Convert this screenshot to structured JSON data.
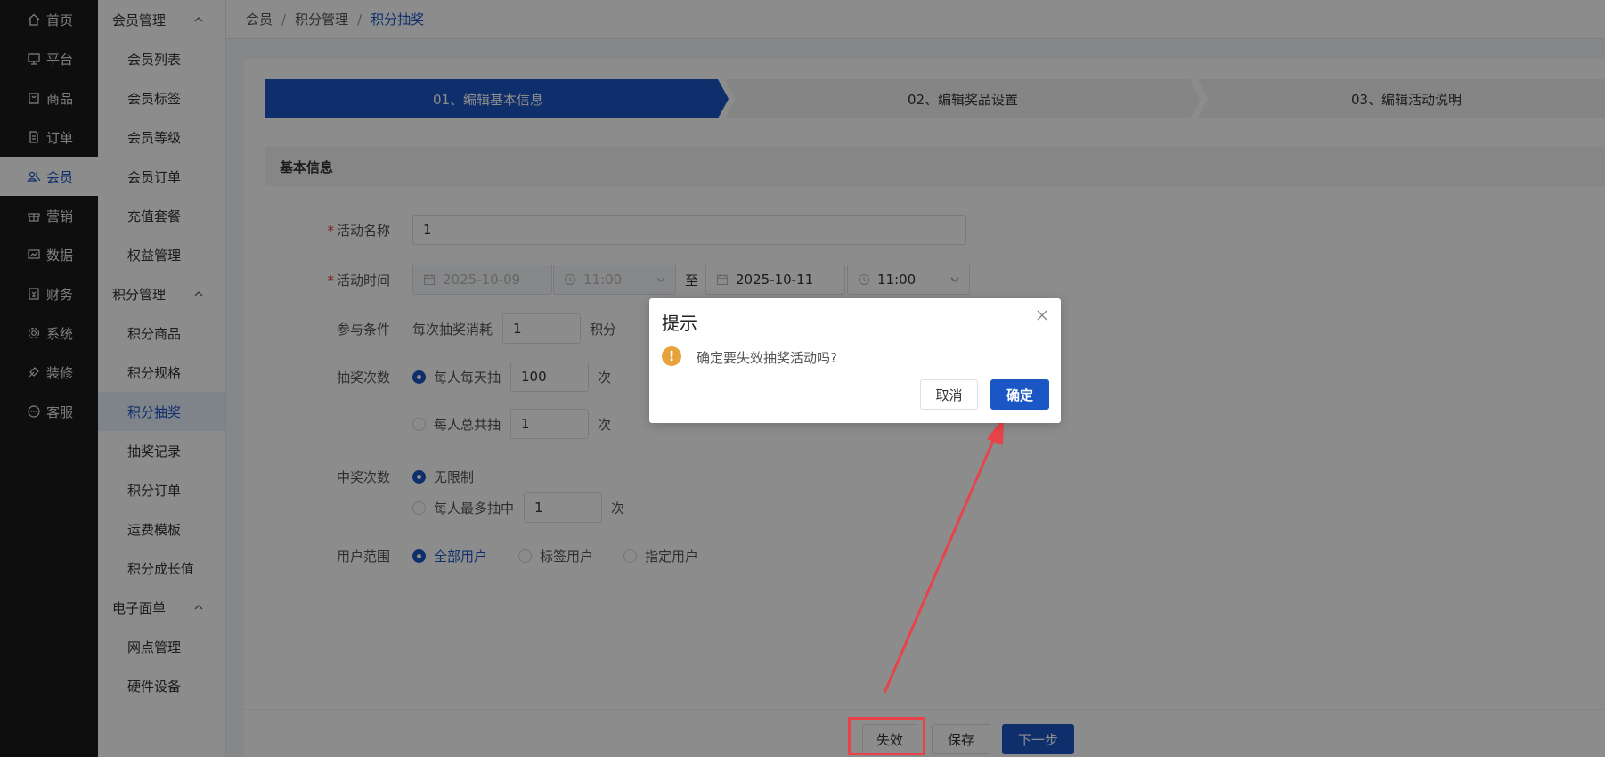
{
  "nav_main": [
    {
      "label": "首页",
      "icon": "home-icon"
    },
    {
      "label": "平台",
      "icon": "monitor-icon"
    },
    {
      "label": "商品",
      "icon": "bag-icon"
    },
    {
      "label": "订单",
      "icon": "document-icon"
    },
    {
      "label": "会员",
      "icon": "users-icon",
      "active": true
    },
    {
      "label": "营销",
      "icon": "gift-icon"
    },
    {
      "label": "数据",
      "icon": "chart-icon"
    },
    {
      "label": "财务",
      "icon": "finance-icon"
    },
    {
      "label": "系统",
      "icon": "gear-icon"
    },
    {
      "label": "装修",
      "icon": "brush-icon"
    },
    {
      "label": "客服",
      "icon": "chat-icon"
    }
  ],
  "nav_sub": {
    "group1": "会员管理",
    "group1_items": [
      "会员列表",
      "会员标签",
      "会员等级",
      "会员订单",
      "充值套餐",
      "权益管理"
    ],
    "group2": "积分管理",
    "group2_items": [
      "积分商品",
      "积分规格",
      "积分抽奖",
      "抽奖记录",
      "积分订单",
      "运费模板",
      "积分成长值"
    ],
    "group3": "电子面单",
    "group3_items": [
      "网点管理",
      "硬件设备"
    ]
  },
  "breadcrumb": [
    "会员",
    "积分管理",
    "积分抽奖"
  ],
  "steps": [
    "01、编辑基本信息",
    "02、编辑奖品设置",
    "03、编辑活动说明"
  ],
  "section_title": "基本信息",
  "form": {
    "name_label": "活动名称",
    "name_value": "1",
    "time_label": "活动时间",
    "start_date": "2025-10-09",
    "start_time": "11:00",
    "to": "至",
    "end_date": "2025-10-11",
    "end_time": "11:00",
    "cond_label": "参与条件",
    "cond_prefix": "每次抽奖消耗",
    "cond_value": "1",
    "cond_unit": "积分",
    "draw_label": "抽奖次数",
    "draw_daily": "每人每天抽",
    "draw_daily_value": "100",
    "draw_total": "每人总共抽",
    "draw_total_value": "1",
    "times_unit": "次",
    "win_label": "中奖次数",
    "win_unlimited": "无限制",
    "win_max": "每人最多抽中",
    "win_max_value": "1",
    "scope_label": "用户范围",
    "scope_all": "全部用户",
    "scope_tag": "标签用户",
    "scope_specified": "指定用户"
  },
  "footer": {
    "invalidate": "失效",
    "save": "保存",
    "next": "下一步"
  },
  "dialog": {
    "title": "提示",
    "message": "确定要失效抽奖活动吗?",
    "cancel": "取消",
    "confirm": "确定"
  },
  "colors": {
    "primary": "#1a56c4",
    "annotation": "#e8434a",
    "warning": "#e6a23c"
  }
}
